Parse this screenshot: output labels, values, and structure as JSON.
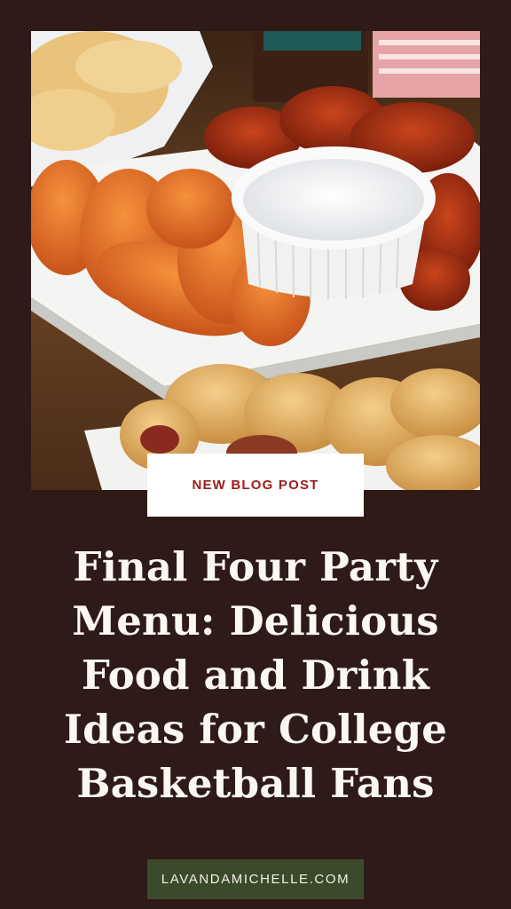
{
  "photo": {
    "subject": "buffalo chicken wings and tenders with ranch dip and pigs in a blanket"
  },
  "badge": {
    "label": "NEW BLOG POST"
  },
  "title": {
    "text": "Final Four Party Menu: Delicious Food and Drink Ideas for College Basketball Fans"
  },
  "website": {
    "label": "LAVANDAMICHELLE.COM"
  },
  "colors": {
    "background": "#2e1a17",
    "badge_bg": "#ffffff",
    "badge_text": "#9e1c1c",
    "title_text": "#fdf7f1",
    "website_bg": "#3b4a2b",
    "website_text": "#f3efe6"
  }
}
